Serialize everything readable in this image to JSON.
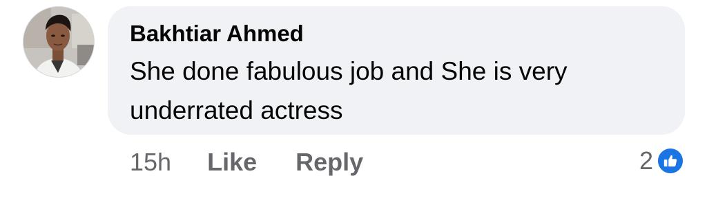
{
  "comment": {
    "author": "Bakhtiar Ahmed",
    "text": "She done fabulous job and She is very underrated actress",
    "timestamp": "15h",
    "like_label": "Like",
    "reply_label": "Reply",
    "reaction_count": "2",
    "reaction_icon": "thumbs-up-icon"
  },
  "colors": {
    "bubble": "#f0f2f5",
    "meta_text": "#65676b",
    "like_blue": "#1b74e4"
  }
}
